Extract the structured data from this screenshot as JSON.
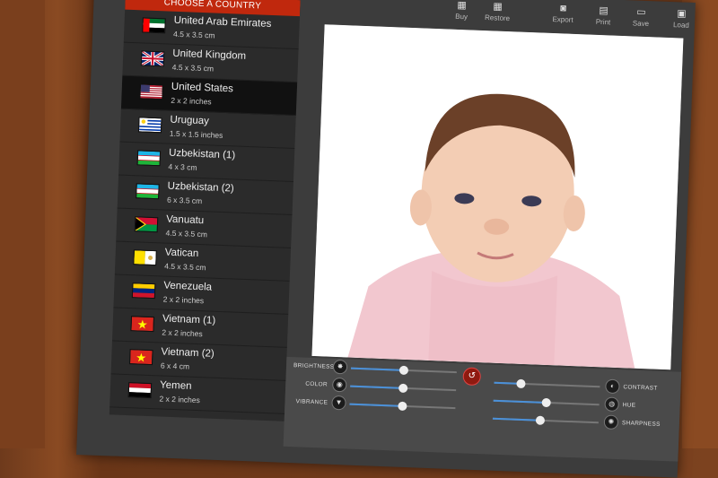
{
  "sidebar": {
    "header": "CHOOSE A COUNTRY",
    "countries": [
      {
        "name": "United Arab Emirates",
        "size": "4.5 x 3.5 cm",
        "flag": "uae-flag"
      },
      {
        "name": "United Kingdom",
        "size": "4.5 x 3.5 cm",
        "flag": "uk-flag"
      },
      {
        "name": "United States",
        "size": "2 x 2 inches",
        "flag": "us-flag",
        "selected": true
      },
      {
        "name": "Uruguay",
        "size": "1.5 x 1.5 inches",
        "flag": "uruguay-flag"
      },
      {
        "name": "Uzbekistan (1)",
        "size": "4 x 3 cm",
        "flag": "uzbekistan-flag"
      },
      {
        "name": "Uzbekistan (2)",
        "size": "6 x 3.5 cm",
        "flag": "uzbekistan-flag"
      },
      {
        "name": "Vanuatu",
        "size": "4.5 x 3.5 cm",
        "flag": "vanuatu-flag"
      },
      {
        "name": "Vatican",
        "size": "4.5 x 3.5 cm",
        "flag": "vatican-flag"
      },
      {
        "name": "Venezuela",
        "size": "2 x 2 inches",
        "flag": "venezuela-flag"
      },
      {
        "name": "Vietnam (1)",
        "size": "2 x 2 inches",
        "flag": "vietnam-flag"
      },
      {
        "name": "Vietnam (2)",
        "size": "6 x 4 cm",
        "flag": "vietnam-flag"
      },
      {
        "name": "Yemen",
        "size": "2 x 2 inches",
        "flag": "yemen-flag"
      }
    ]
  },
  "toolbar": {
    "buy": "Buy",
    "restore": "Restore",
    "export": "Export",
    "print": "Print",
    "save": "Save",
    "load": "Load"
  },
  "controls": {
    "brightness": {
      "label": "BRIGHTNESS",
      "value": 0.5
    },
    "color": {
      "label": "COLOR",
      "value": 0.5
    },
    "vibrance": {
      "label": "VIBRANCE",
      "value": 0.5
    },
    "contrast": {
      "label": "CONTRAST",
      "value": 0.25
    },
    "hue": {
      "label": "HUE",
      "value": 0.5
    },
    "sharpness": {
      "label": "SHARPNESS",
      "value": 0.45
    }
  },
  "colors": {
    "accent": "#c0280d",
    "slider": "#4a90d9"
  }
}
